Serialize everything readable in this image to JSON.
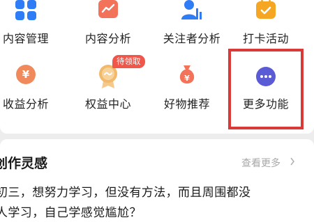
{
  "tools_row1": [
    {
      "label": "内容管理",
      "icon": "grid-squares-icon",
      "color": "#2f7df6"
    },
    {
      "label": "内容分析",
      "icon": "trend-chart-icon",
      "color": "#f2725a"
    },
    {
      "label": "关注者分析",
      "icon": "user-chart-icon",
      "color": "#2f7df6"
    },
    {
      "label": "打卡活动",
      "icon": "calendar-check-icon",
      "color": "#f5a623"
    }
  ],
  "tools_row2": [
    {
      "label": "收益分析",
      "icon": "yen-coin-icon",
      "color": "#f08a5d"
    },
    {
      "label": "权益中心",
      "icon": "medal-icon",
      "color": "#f2b96b",
      "badge": "待领取"
    },
    {
      "label": "好物推荐",
      "icon": "money-bag-icon",
      "color": "#f2725a"
    },
    {
      "label": "更多功能",
      "icon": "more-dots-icon",
      "color": "#5b5bd6"
    }
  ],
  "inspiration": {
    "title": "创作灵感",
    "see_more": "查看更多",
    "line1": "初三，想努力学习，但没有方法，而且周围都没",
    "line2": "人学习，自己学感觉尴尬？"
  },
  "colors": {
    "highlight": "#d93a37",
    "badge": "#f0564a"
  }
}
